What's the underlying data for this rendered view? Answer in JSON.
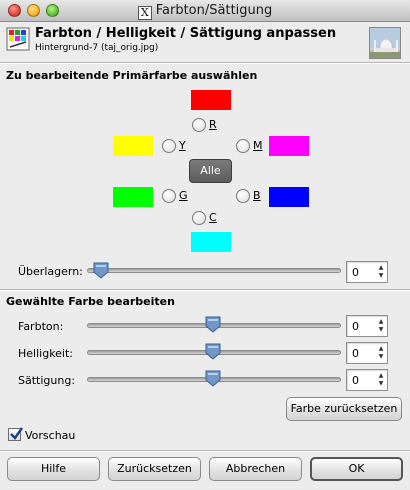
{
  "window": {
    "title": "Farbton/Sättigung",
    "title_glyph": "X"
  },
  "header": {
    "title": "Farbton / Helligkeit / Sättigung anpassen",
    "subtitle": "Hintergrund-7 (taj_orig.jpg)"
  },
  "primary": {
    "heading": "Zu bearbeitende Primärfarbe auswählen",
    "colors": {
      "R": "#ff0000",
      "Y": "#ffff00",
      "M": "#ff00ff",
      "G": "#00ff00",
      "B": "#0000ff",
      "C": "#00ffff"
    },
    "labels": {
      "R": "R",
      "Y": "Y",
      "M": "M",
      "G": "G",
      "B": "B",
      "C": "C"
    },
    "all_button": "Alle"
  },
  "overlap": {
    "label": "Überlagern:",
    "value": "0"
  },
  "edit": {
    "heading": "Gewählte Farbe bearbeiten",
    "hue": {
      "label": "Farbton:",
      "value": "0"
    },
    "lightness": {
      "label": "Helligkeit:",
      "value": "0"
    },
    "saturation": {
      "label": "Sättigung:",
      "value": "0"
    },
    "reset_color": "Farbe zurücksetzen"
  },
  "preview": {
    "label": "Vorschau",
    "checked": true
  },
  "buttons": {
    "help": "Hilfe",
    "reset": "Zurücksetzen",
    "cancel": "Abbrechen",
    "ok": "OK"
  }
}
